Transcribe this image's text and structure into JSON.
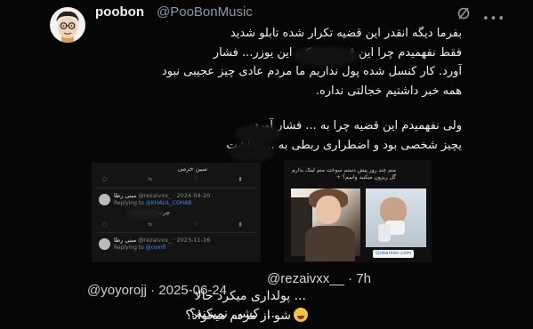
{
  "tweet": {
    "display_name": "poobon",
    "handle": "@PooBonMusic",
    "lines": [
      "بفرما دیگه انقدر این قضیه تکرار شده تابلو شدید",
      "فقط نفهمیدم چرا این قضیه رو کی این یوزر... فشار",
      "آورد. کار کنسل شده پول نداریم ما مردم عادی چیز عجیبی نبود",
      "همه خبر داشتیم خجالتی نداره.",
      "ولی نفهمیدم این قضیه چرا به ... فشار آورد",
      "یچیز شخصی بود و اضطراری ربطی به ... نداشت"
    ]
  },
  "left_screenshot": {
    "title": "سین خرمی",
    "reply1": {
      "name": "مبنی رطا",
      "meta": "@rezaivxx_ · 2024-04-20",
      "replying": "Replying to",
      "to": "@KHALIL_COHAB",
      "text": "چرت با ..."
    },
    "reply2": {
      "name": "مبنی رطا",
      "meta": "@rezaivxx_ · 2023-11-16",
      "replying": "Replying to",
      "to": "@comfi"
    }
  },
  "right_screenshot": {
    "caption": "منم چند روز پیش دستم سوخت منم لینک بذارم گل ریزون میکنید واسم؟",
    "caption_plus": "+",
    "site_label": "Gobanlen.com"
  },
  "quoted": {
    "handle": "@rezaivxx__",
    "time": "7h"
  },
  "reply": {
    "handle": "@yoyorojj",
    "date": "2025-06-24"
  },
  "overlay_lines": [
    "... پولداری میکرد حالا",
    "... کشی نمیکنه؟",
    "شو از مردم میخواد؟"
  ],
  "icons": {
    "avatar": "cartoon-avatar",
    "grok": "grok-icon",
    "more": "more-icon",
    "emoji": "laughing-emoji"
  }
}
